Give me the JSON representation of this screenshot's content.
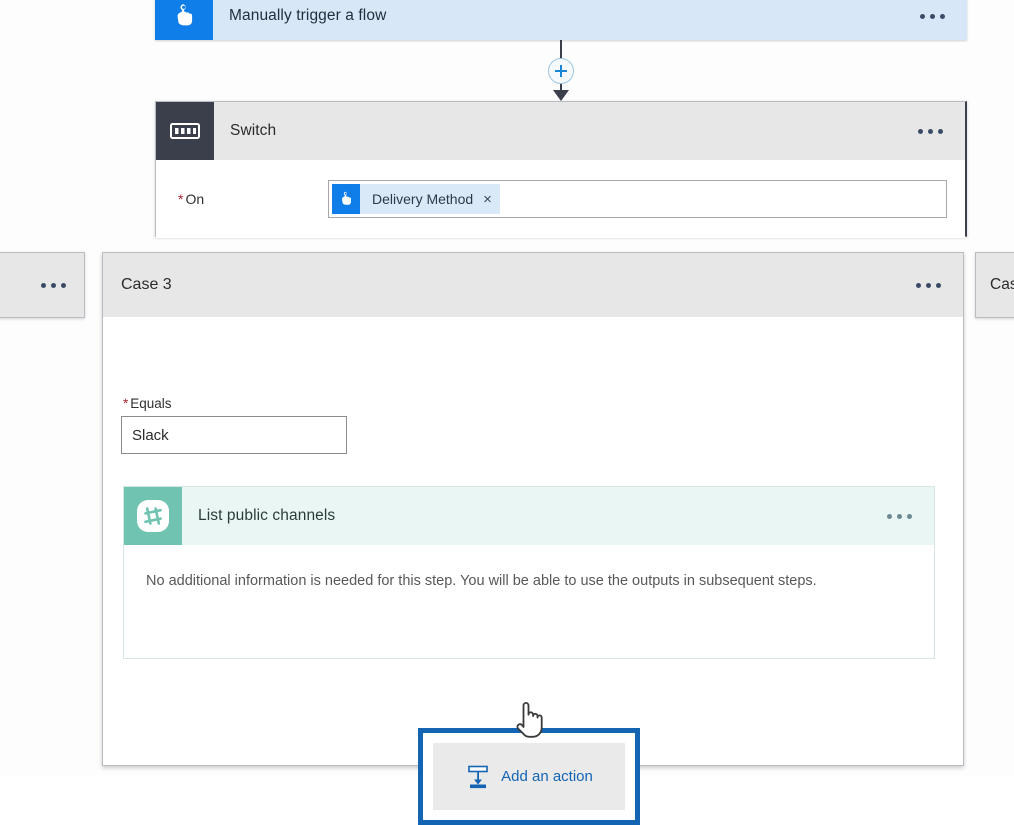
{
  "trigger": {
    "title": "Manually trigger a flow",
    "icon": "hand-tap-icon",
    "menu": "more-options",
    "accent": "#0f7ee8",
    "background": "#d7e7f8"
  },
  "connector": {
    "add_icon": "plus-icon",
    "arrow_icon": "arrow-down-icon"
  },
  "switch": {
    "title": "Switch",
    "icon": "switch-icon",
    "menu": "more-options",
    "accent": "#3b3f4b",
    "field": {
      "label": "On",
      "required": true,
      "required_marker": "*",
      "token": {
        "label": "Delivery Method",
        "icon": "hand-tap-icon",
        "remove": "×"
      }
    }
  },
  "side_cases": {
    "left": {
      "title": "",
      "menu": "more-options"
    },
    "right": {
      "title": "Cas"
    }
  },
  "case": {
    "title": "Case 3",
    "menu": "more-options",
    "equals": {
      "label": "Equals",
      "required": true,
      "required_marker": "*",
      "value": "Slack",
      "placeholder": ""
    },
    "action": {
      "title": "List public channels",
      "icon": "slack-icon",
      "menu": "more-options",
      "accent": "#6fc3b0",
      "body": "No additional information is needed for this step. You will be able to use the outputs in subsequent steps."
    },
    "add_action": {
      "label": "Add an action",
      "icon": "insert-below-icon",
      "highlight_color": "#1464b4"
    }
  },
  "cursor": {
    "icon": "hand-pointer-cursor"
  }
}
